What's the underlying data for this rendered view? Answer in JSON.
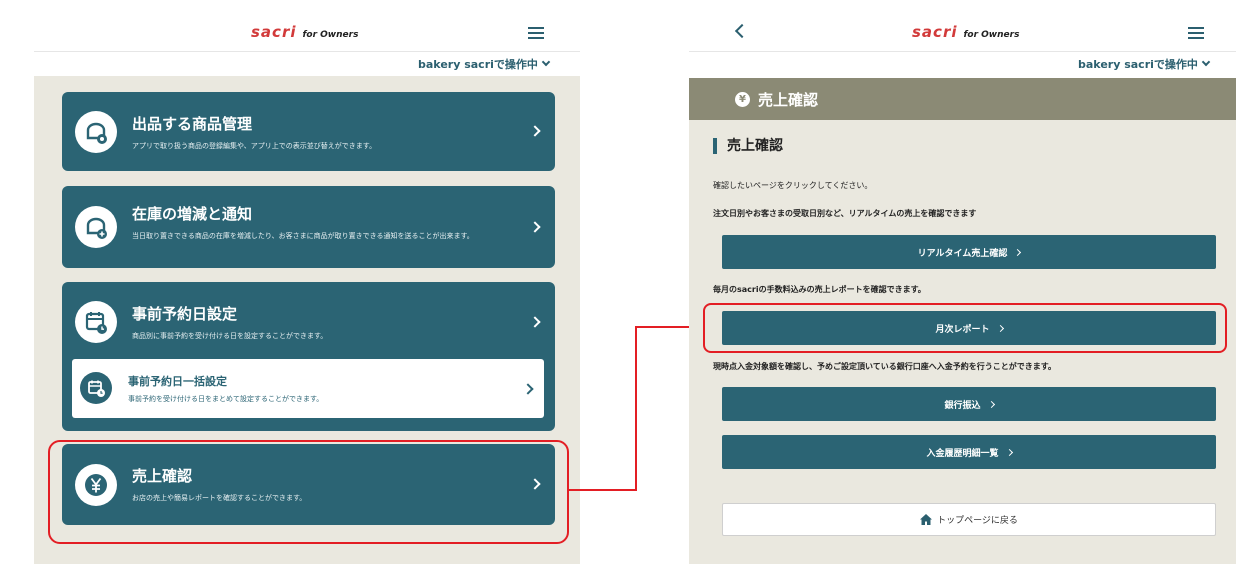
{
  "left": {
    "header": {
      "brand": "sacri",
      "brand_sub": "for Owners",
      "store": "bakery sacriで操作中"
    },
    "cards": [
      {
        "title": "出品する商品管理",
        "desc": "アプリで取り扱う商品の登録編集や、アプリ上での表示並び替えができます。",
        "icon": "bread-gear-icon"
      },
      {
        "title": "在庫の増減と通知",
        "desc": "当日取り置きできる商品の在庫を増減したり、お客さまに商品が取り置きできる通知を送ることが出来ます。",
        "icon": "bread-plus-icon"
      },
      {
        "title": "事前予約日設定",
        "desc": "商品別に事前予約を受け付ける日を設定することができます。",
        "icon": "calendar-clock-icon"
      },
      {
        "title": "売上確認",
        "desc": "お店の売上や簡易レポートを確認することができます。",
        "icon": "yen-icon"
      }
    ],
    "sub_card": {
      "title": "事前予約日一括設定",
      "desc": "事前予約を受け付ける日をまとめて設定することができます。",
      "icon": "calendar-clock-icon"
    }
  },
  "right": {
    "header": {
      "brand": "sacri",
      "brand_sub": "for Owners",
      "store": "bakery sacriで操作中"
    },
    "banner": "売上確認",
    "banner_icon": "¥",
    "heading": "売上確認",
    "intro": "確認したいページをクリックしてください。",
    "sections": [
      {
        "text": "注文日別やお客さまの受取日別など、リアルタイムの売上を確認できます",
        "button": "リアルタイム売上確認"
      },
      {
        "text": "毎月のsacriの手数料込みの売上レポートを確認できます。",
        "button": "月次レポート"
      },
      {
        "text": "現時点入金対象額を確認し、予めご設定頂いている銀行口座へ入金予約を行うことができます。",
        "button": "銀行振込"
      },
      {
        "text": "",
        "button": "入金履歴明細一覧"
      }
    ],
    "top_button": "トップページに戻る"
  },
  "colors": {
    "teal": "#2b6474",
    "khaki": "#8b8a75",
    "highlight": "#e31e24",
    "brand_red": "#d23a3a"
  }
}
